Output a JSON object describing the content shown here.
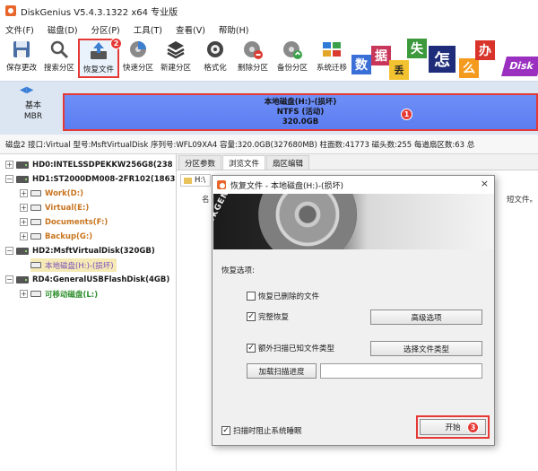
{
  "window": {
    "title": "DiskGenius V5.4.3.1322 x64 专业版"
  },
  "menu": [
    "文件(F)",
    "磁盘(D)",
    "分区(P)",
    "工具(T)",
    "查看(V)",
    "帮助(H)"
  ],
  "toolbar": {
    "items": [
      {
        "label": "保存更改",
        "icon": "save-icon"
      },
      {
        "label": "搜索分区",
        "icon": "search-icon"
      },
      {
        "label": "恢复文件",
        "icon": "recover-files-icon",
        "badge": "2"
      },
      {
        "label": "快速分区",
        "icon": "quick-partition-icon"
      },
      {
        "label": "新建分区",
        "icon": "new-partition-icon"
      },
      {
        "label": "格式化",
        "icon": "format-icon"
      },
      {
        "label": "删除分区",
        "icon": "delete-partition-icon"
      },
      {
        "label": "备份分区",
        "icon": "backup-partition-icon"
      },
      {
        "label": "系统迁移",
        "icon": "system-migration-icon"
      }
    ]
  },
  "ad": {
    "chars": [
      "数",
      "据",
      "丢",
      "失",
      "怎",
      "么",
      "办"
    ],
    "tail": "Disk"
  },
  "disk_bar": {
    "type_line1": "基本",
    "type_line2": "MBR",
    "partition_name": "本地磁盘(H:)-(损坏)",
    "partition_fs": "NTFS (活动)",
    "partition_size": "320.0GB",
    "badge": "1"
  },
  "disk_info": "磁盘2 接口:Virtual  型号:MsftVirtualDisk  序列号:WFL09XA4  容量:320.0GB(327680MB)  柱面数:41773  磁头数:255  每道扇区数:63  总",
  "tree": {
    "hd0": "HD0:INTELSSDPEKKW256G8(238",
    "hd1": "HD1:ST2000DM008-2FR102(1863",
    "work": "Work(D:)",
    "virtual": "Virtual(E:)",
    "documents": "Documents(F:)",
    "backup": "Backup(G:)",
    "hd2": "HD2:MsftVirtualDisk(320GB)",
    "local": "本地磁盘(H:)-(损坏)",
    "rd4": "RD4:GeneralUSBFlashDisk(4GB)",
    "removable": "可移动磁盘(L:)"
  },
  "tabs": [
    "分区参数",
    "浏览文件",
    "扇区编辑"
  ],
  "path_label": "H:\\",
  "bg_columns": {
    "name": "名",
    "short": "短文件。"
  },
  "dialog": {
    "title": "恢复文件 - 本地磁盘(H:)-(损坏)",
    "close": "×",
    "banner_brand": "DISKGENIUS",
    "options_label": "恢复选项:",
    "recover_deleted": "恢复已删除的文件",
    "recover_deleted_checked": false,
    "full_recovery": "完整恢复",
    "full_recovery_checked": true,
    "advanced_button": "高级选项",
    "extra_scan": "额外扫描已知文件类型",
    "extra_scan_checked": true,
    "select_types_button": "选择文件类型",
    "load_progress_button": "加载扫描进度",
    "prevent_sleep": "扫描时阻止系统睡眠",
    "prevent_sleep_checked": true,
    "start_button": "开始",
    "start_badge": "3"
  },
  "colors": {
    "accent_red": "#e53935",
    "partition_blue": "#6f8ff7",
    "disk_bar_bg": "#dce6f2"
  }
}
